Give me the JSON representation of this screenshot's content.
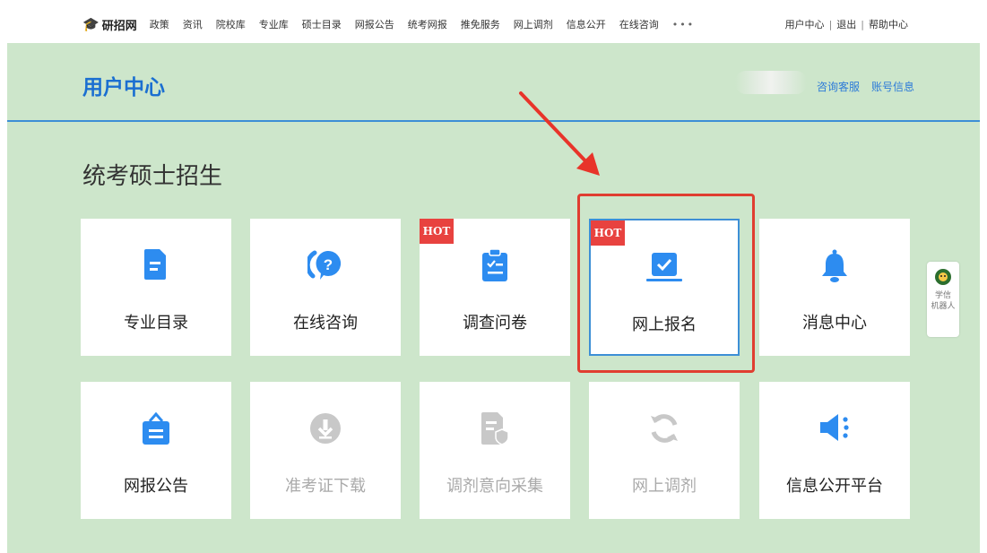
{
  "topnav": {
    "logo_text": "研招网",
    "links": [
      "政策",
      "资讯",
      "院校库",
      "专业库",
      "硕士目录",
      "网报公告",
      "统考网报",
      "推免服务",
      "网上调剂",
      "信息公开",
      "在线咨询"
    ],
    "more": "•••",
    "right": {
      "user_center": "用户中心",
      "logout": "退出",
      "help": "帮助中心",
      "sep": "|"
    }
  },
  "header": {
    "title": "用户中心",
    "consult_service": "咨询客服",
    "account_info": "账号信息"
  },
  "section": {
    "title": "统考硕士招生"
  },
  "tiles": [
    {
      "label": "专业目录",
      "icon": "document-icon",
      "enabled": true,
      "hot": false
    },
    {
      "label": "在线咨询",
      "icon": "question-chat-icon",
      "enabled": true,
      "hot": false
    },
    {
      "label": "调查问卷",
      "icon": "clipboard-checklist-icon",
      "enabled": true,
      "hot": true
    },
    {
      "label": "网上报名",
      "icon": "laptop-check-icon",
      "enabled": true,
      "hot": true
    },
    {
      "label": "消息中心",
      "icon": "bell-icon",
      "enabled": true,
      "hot": false
    },
    {
      "label": "网报公告",
      "icon": "notice-bag-icon",
      "enabled": true,
      "hot": false
    },
    {
      "label": "准考证下载",
      "icon": "download-circle-icon",
      "enabled": false,
      "hot": false
    },
    {
      "label": "调剂意向采集",
      "icon": "document-shield-icon",
      "enabled": false,
      "hot": false
    },
    {
      "label": "网上调剂",
      "icon": "refresh-icon",
      "enabled": false,
      "hot": false
    },
    {
      "label": "信息公开平台",
      "icon": "speaker-icon",
      "enabled": true,
      "hot": false
    }
  ],
  "hot_badge": "HOT",
  "robot": {
    "line1": "学信",
    "line2": "机器人"
  },
  "colors": {
    "page_bg": "#cde6cb",
    "accent_blue": "#1b6fd1",
    "icon_blue": "#2d8cf0",
    "hot_red": "#e8423f",
    "highlight_red": "#e03d30",
    "disabled_gray": "#c8c8c8"
  }
}
